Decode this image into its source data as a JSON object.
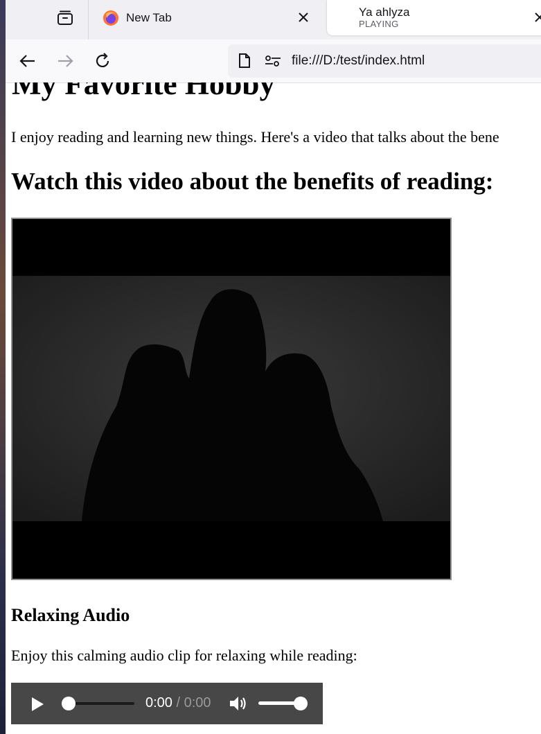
{
  "browser": {
    "tabs": [
      {
        "title": "New Tab"
      },
      {
        "title": "Ya ahlyza",
        "status": "PLAYING"
      }
    ],
    "url": "file:///D:/test/index.html"
  },
  "page": {
    "heading": "My Favorite Hobby",
    "intro": "I enjoy reading and learning new things. Here's a video that talks about the bene",
    "video_heading": "Watch this video about the benefits of reading:",
    "audio_heading": "Relaxing Audio",
    "audio_text": "Enjoy this calming audio clip for relaxing while reading:",
    "audio_player": {
      "current_time": "0:00",
      "duration": "/ 0:00",
      "progress": 0,
      "volume": 1
    }
  },
  "colors": {
    "tabstrip": "#f0f0f4",
    "audio_bg": "#474747"
  }
}
